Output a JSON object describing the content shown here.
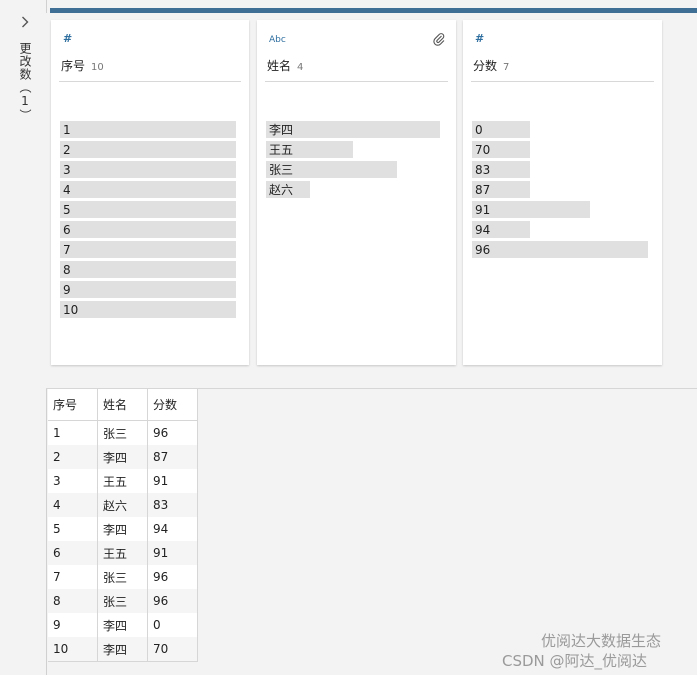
{
  "side_panel": {
    "label": "更改数（1）"
  },
  "profile_cards": [
    {
      "type_icon": "#",
      "name": "序号",
      "count": "10",
      "bars": [
        {
          "label": "1",
          "fraction": 1.0
        },
        {
          "label": "2",
          "fraction": 1.0
        },
        {
          "label": "3",
          "fraction": 1.0
        },
        {
          "label": "4",
          "fraction": 1.0
        },
        {
          "label": "5",
          "fraction": 1.0
        },
        {
          "label": "6",
          "fraction": 1.0
        },
        {
          "label": "7",
          "fraction": 1.0
        },
        {
          "label": "8",
          "fraction": 1.0
        },
        {
          "label": "9",
          "fraction": 1.0
        },
        {
          "label": "10",
          "fraction": 1.0
        }
      ]
    },
    {
      "type_icon": "Abc",
      "name": "姓名",
      "count": "4",
      "has_attachment_icon": true,
      "bars": [
        {
          "label": "李四",
          "fraction": 1.0
        },
        {
          "label": "王五",
          "fraction": 0.5
        },
        {
          "label": "张三",
          "fraction": 0.75
        },
        {
          "label": "赵六",
          "fraction": 0.25
        }
      ]
    },
    {
      "type_icon": "#",
      "name": "分数",
      "count": "7",
      "bars": [
        {
          "label": "0",
          "fraction": 0.33
        },
        {
          "label": "70",
          "fraction": 0.33
        },
        {
          "label": "83",
          "fraction": 0.33
        },
        {
          "label": "87",
          "fraction": 0.33
        },
        {
          "label": "91",
          "fraction": 0.67
        },
        {
          "label": "94",
          "fraction": 0.33
        },
        {
          "label": "96",
          "fraction": 1.0
        }
      ]
    }
  ],
  "table": {
    "columns": [
      "序号",
      "姓名",
      "分数"
    ],
    "rows": [
      [
        "1",
        "张三",
        "96"
      ],
      [
        "2",
        "李四",
        "87"
      ],
      [
        "3",
        "王五",
        "91"
      ],
      [
        "4",
        "赵六",
        "83"
      ],
      [
        "5",
        "李四",
        "94"
      ],
      [
        "6",
        "王五",
        "91"
      ],
      [
        "7",
        "张三",
        "96"
      ],
      [
        "8",
        "张三",
        "96"
      ],
      [
        "9",
        "李四",
        "0"
      ],
      [
        "10",
        "李四",
        "70"
      ]
    ]
  },
  "watermark": {
    "line1": "优阅达大数据生态",
    "line2": "CSDN @阿达_优阅达"
  },
  "colors": {
    "accent": "#3f6f95",
    "bar": "#e0e0e0",
    "icon": "#2f6f9f"
  }
}
